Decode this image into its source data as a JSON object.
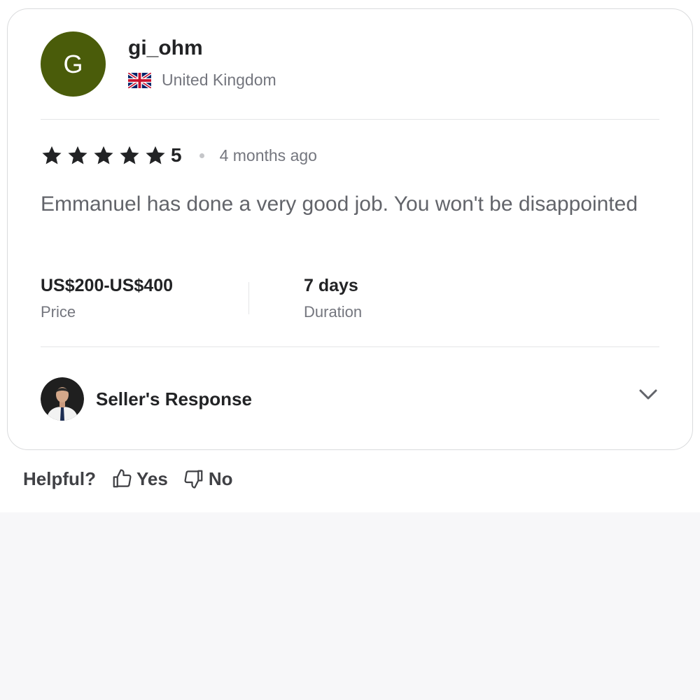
{
  "reviewer": {
    "avatar_letter": "G",
    "name": "gi_ohm",
    "country": "United Kingdom",
    "flag_icon": "uk-flag-icon",
    "avatar_color": "#4a5c0a"
  },
  "rating": {
    "stars": 5,
    "value": "5",
    "time_ago": "4 months ago"
  },
  "review_text": "Emmanuel has done a very good job. You won't be disappointed",
  "stats": {
    "price_value": "US$200-US$400",
    "price_label": "Price",
    "duration_value": "7 days",
    "duration_label": "Duration"
  },
  "seller_response": {
    "label": "Seller's Response",
    "toggle_icon": "chevron-down-icon"
  },
  "helpful": {
    "label": "Helpful?",
    "yes_label": "Yes",
    "no_label": "No"
  },
  "colors": {
    "text_primary": "#222325",
    "text_secondary": "#74767e",
    "border": "#dadbdd",
    "page_background": "#f7f7f9"
  }
}
